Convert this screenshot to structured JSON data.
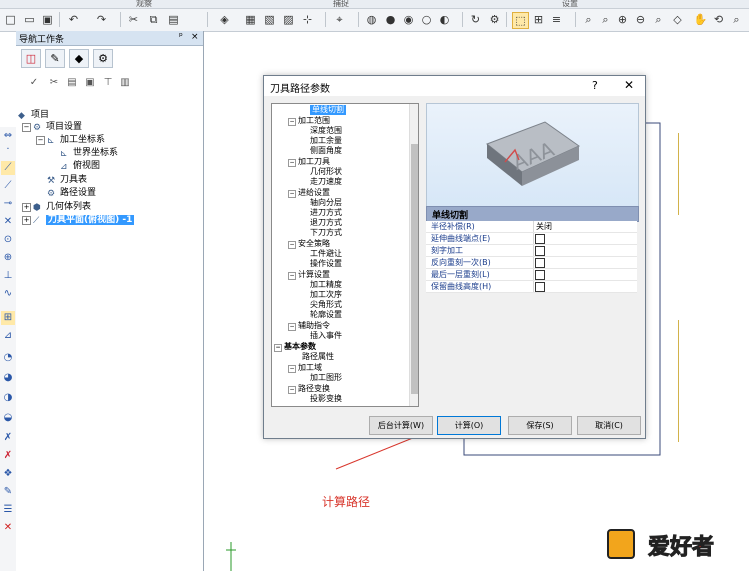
{
  "ribbon": {
    "groups": [
      "观察",
      "捕捉",
      "设置"
    ]
  },
  "nav": {
    "title": "导航工作条",
    "pin": "ᵖ",
    "close": "×",
    "tree": [
      {
        "label": "项目"
      },
      {
        "label": "项目设置"
      },
      {
        "label": "加工坐标系"
      },
      {
        "label": "世界坐标系"
      },
      {
        "label": "俯视图"
      },
      {
        "label": "刀具表"
      },
      {
        "label": "路径设置"
      },
      {
        "label": "几何体列表"
      },
      {
        "label": "刀具平面(俯视图) -1"
      }
    ]
  },
  "dialog": {
    "title": "刀具路径参数",
    "help": "?",
    "close": "✕",
    "tree": [
      "单线切割",
      "加工范围",
      "深度范围",
      "加工余量",
      "侧面角度",
      "加工刀具",
      "几何形状",
      "走刀速度",
      "进给设置",
      "轴向分层",
      "进刀方式",
      "退刀方式",
      "下刀方式",
      "安全策略",
      "工件避让",
      "操作设置",
      "计算设置",
      "加工精度",
      "加工次序",
      "尖角形式",
      "轮廓设置",
      "辅助指令",
      "插入事件",
      "基本参数",
      "路径属性",
      "加工域",
      "加工图形",
      "路径变换",
      "投影变换"
    ],
    "preview_letters": "AAA",
    "prop_title": "单线切割",
    "props": [
      {
        "label": "半径补偿(R)",
        "value": "关闭"
      },
      {
        "label": "延伸曲线端点(E)",
        "value": ""
      },
      {
        "label": "刻字加工",
        "value": ""
      },
      {
        "label": "反向重刻一次(B)",
        "value": ""
      },
      {
        "label": "最后一层重刻(L)",
        "value": ""
      },
      {
        "label": "保留曲线高度(H)",
        "value": ""
      }
    ],
    "buttons": {
      "background": "后台计算(W)",
      "calc": "计算(O)",
      "save": "保存(S)",
      "cancel": "取消(C)"
    }
  },
  "annotation": {
    "text": "计算路径",
    "color": "#d8362c"
  },
  "watermark": {
    "text": "爱好者"
  },
  "colors": {
    "selection": "#3399ff",
    "prop_header": "#98a9c9",
    "canvas_line": "#d2b24a",
    "frame": "#3a4a7a"
  }
}
